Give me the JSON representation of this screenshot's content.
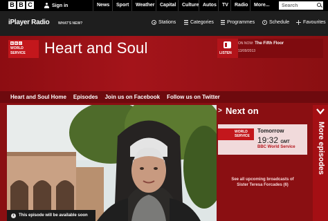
{
  "bbc_bar": {
    "logo": [
      "B",
      "B",
      "C"
    ],
    "signin": "Sign in",
    "nav": [
      "News",
      "Sport",
      "Weather",
      "Capital",
      "Culture",
      "Autos",
      "TV",
      "Radio",
      "More..."
    ],
    "search_placeholder": "Search"
  },
  "radio_bar": {
    "brand": "iPlayer Radio",
    "whats_new": "WHAT'S NEW?",
    "nav": [
      {
        "label": "Stations",
        "icon": "stations-icon"
      },
      {
        "label": "Categories",
        "icon": "categories-icon"
      },
      {
        "label": "Programmes",
        "icon": "programmes-icon"
      },
      {
        "label": "Schedule",
        "icon": "schedule-icon"
      },
      {
        "label": "Favourites",
        "icon": "favourites-icon"
      }
    ]
  },
  "station": {
    "logo_line1": "WORLD",
    "logo_line2": "SERVICE"
  },
  "programme": {
    "title": "Heart and Soul"
  },
  "on_now": {
    "listen": "LISTEN",
    "prefix": "ON NOW:",
    "title": "The Fifth Floor",
    "date": "13/09/2013"
  },
  "prog_nav": [
    "Heart and Soul Home",
    "Episodes",
    "Join us on Facebook",
    "Follow us on Twitter"
  ],
  "notice": "This episode will be available soon",
  "next_on": {
    "heading": "Next on",
    "badge_line1": "WORLD",
    "badge_line2": "SERVICE",
    "day": "Tomorrow",
    "time": "19:32",
    "tz": "GMT",
    "station": "BBC World Service",
    "see_all_line1": "See all upcoming broadcasts of",
    "see_all_line2": "Sister Teresa Forcades (6)"
  },
  "more_episodes": "More episodes",
  "colors": {
    "bbc_red": "#c3171c",
    "header_red": "#a4141a",
    "nav_dark_red": "#6e0a0e"
  }
}
